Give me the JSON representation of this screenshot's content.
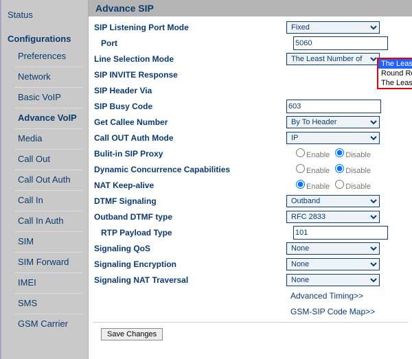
{
  "sidebar": {
    "status": "Status",
    "configurations": "Configurations",
    "items": [
      "Preferences",
      "Network",
      "Basic VoIP",
      "Advance VoIP",
      "Media",
      "Call Out",
      "Call Out Auth",
      "Call In",
      "Call In Auth",
      "SIM",
      "SIM Forward",
      "IMEI",
      "SMS",
      "GSM Carrier"
    ],
    "selected_index": 3
  },
  "page_title": "Advance SIP",
  "labels": {
    "sip_port_mode": "SIP Listening Port Mode",
    "port": "Port",
    "line_selection": "Line Selection Mode",
    "sip_invite": "SIP INVITE Response",
    "sip_header_via": "SIP Header Via",
    "sip_busy_code": "SIP Busy Code",
    "get_callee": "Get Callee Number",
    "call_out_auth": "Call OUT Auth Mode",
    "builtin_proxy": "Bulit-in SIP Proxy",
    "dyn_conc": "Dynamic Concurrence Capabilities",
    "nat_keep": "NAT Keep-alive",
    "dtmf_sig": "DTMF Signaling",
    "outband_dtmf": "Outband DTMF type",
    "rtp_payload": "RTP Payload Type",
    "sig_qos": "Signaling QoS",
    "sig_enc": "Signaling Encryption",
    "sig_nat": "Signaling NAT Traversal"
  },
  "values": {
    "sip_port_mode": "Fixed",
    "port": "5060",
    "line_selection": "The Least Number of",
    "sip_busy_code": "603",
    "get_callee": "By To Header",
    "call_out_auth": "IP",
    "dtmf_sig": "Outband",
    "outband_dtmf": "RFC 2833",
    "rtp_payload": "101",
    "sig_qos": "None",
    "sig_enc": "None",
    "sig_nat": "None"
  },
  "radio_labels": {
    "enable": "Enable",
    "disable": "Disable"
  },
  "radio_state": {
    "builtin_proxy": "disable",
    "dyn_conc": "disable",
    "nat_keep": "enable"
  },
  "dropdown_open": {
    "options": [
      "The Least Number of Calls",
      "Round Robin",
      "The Least Amount of Talk Time"
    ],
    "selected_index": 0
  },
  "links": {
    "adv_timing": "Advanced Timing>>",
    "gsm_sip_map": "GSM-SIP Code Map>>"
  },
  "buttons": {
    "save": "Save Changes"
  }
}
